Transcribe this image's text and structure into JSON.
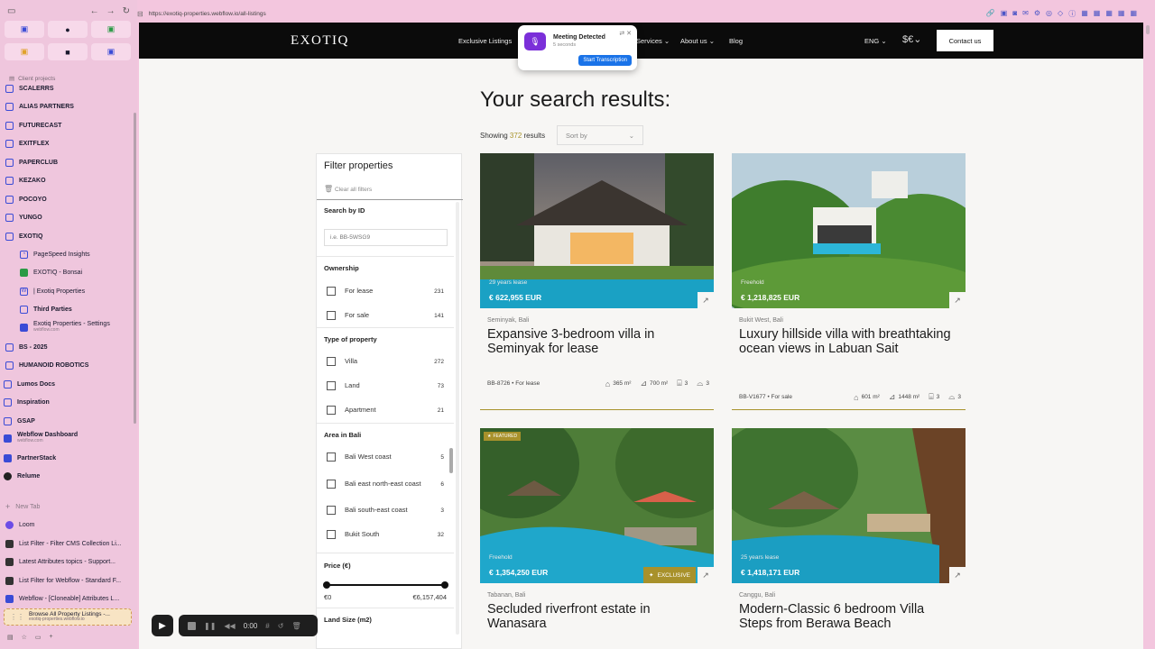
{
  "browser": {
    "url": "https://exotiq-properties.webflow.io/all-listings",
    "sidebar": {
      "section_label": "Client projects",
      "projects": [
        "SCALERRS",
        "ALIAS PARTNERS",
        "FUTURECAST",
        "EXITFLEX",
        "PAPERCLUB",
        "KEZAKO",
        "POCOYO",
        "YUNGO",
        "EXOTIQ"
      ],
      "exotiq_children": [
        {
          "label": "PageSpeed Insights"
        },
        {
          "label": "EXOTIQ - Bonsai"
        },
        {
          "label": "| Exotiq Properties"
        },
        {
          "label": "Third Parties"
        },
        {
          "label": "Exotiq Properties - Settings",
          "sub": "webflow.com"
        }
      ],
      "more_projects": [
        "BS - 2025",
        "HUMANOID ROBOTICS"
      ],
      "folders": [
        {
          "label": "Lumos Docs"
        },
        {
          "label": "Inspiration"
        },
        {
          "label": "GSAP"
        },
        {
          "label": "Webflow Dashboard",
          "sub": "webflow.com"
        },
        {
          "label": "PartnerStack"
        },
        {
          "label": "Relume"
        }
      ],
      "new_tab": "New Tab",
      "tabs": [
        "Loom",
        "List Filter - Filter CMS Collection Li...",
        "Latest Attributes topics - Support...",
        "List Filter for Webflow - Standard F...",
        "Webflow - [Cloneable] Attributes L..."
      ],
      "active_tab": {
        "label": "Browse All Property Listings -...",
        "sub": "exotiq-properties.webflow.io"
      }
    },
    "recorder": {
      "time": "0:00"
    }
  },
  "site": {
    "logo": "EXOTIQ",
    "nav": {
      "links": [
        "Exclusive Listings",
        "Services",
        "About us",
        "Blog"
      ],
      "language": "ENG",
      "contact": "Contact us"
    },
    "popup": {
      "title": "Meeting Detected",
      "subtitle": "5 seconds",
      "button": "Start Transcription"
    },
    "heading": "Your search results:",
    "showing": {
      "prefix": "Showing",
      "count": "372",
      "suffix": "results"
    },
    "sort_placeholder": "Sort by",
    "filter": {
      "title": "Filter properties",
      "clear": "Clear all filters",
      "search_label": "Search by ID",
      "search_placeholder": "i.e. BB-5WSG9",
      "ownership_label": "Ownership",
      "ownership": [
        {
          "label": "For lease",
          "count": "231"
        },
        {
          "label": "For sale",
          "count": "141"
        }
      ],
      "type_label": "Type of property",
      "types": [
        {
          "label": "Villa",
          "count": "272"
        },
        {
          "label": "Land",
          "count": "73"
        },
        {
          "label": "Apartment",
          "count": "21"
        }
      ],
      "area_label": "Area in Bali",
      "areas": [
        {
          "label": "Bali West coast",
          "count": "5"
        },
        {
          "label": "Bali east north-east coast",
          "count": "6"
        },
        {
          "label": "Bali south-east coast",
          "count": "3"
        },
        {
          "label": "Bukit South",
          "count": "32"
        }
      ],
      "price_label": "Price (€)",
      "price_min": "€0",
      "price_max": "€6,157,404",
      "land_label": "Land Size (m2)"
    },
    "listings": [
      {
        "tag": "29 years lease",
        "price": "€ 622,955 EUR",
        "location": "Seminyak, Bali",
        "title": "Expansive 3-bedroom villa in Seminyak for lease",
        "id": "BB-8726",
        "status": "For lease",
        "building": "365 m²",
        "land": "700 m²",
        "beds": "3",
        "baths": "3"
      },
      {
        "tag": "Freehold",
        "price": "€ 1,218,825 EUR",
        "location": "Bukit West, Bali",
        "title": "Luxury hillside villa with breathtaking ocean views in Labuan Sait",
        "id": "BB-V1677",
        "status": "For sale",
        "building": "601 m²",
        "land": "1448 m²",
        "beds": "3",
        "baths": "3"
      },
      {
        "tag": "Freehold",
        "price": "€ 1,354,250 EUR",
        "location": "Tabanan, Bali",
        "title": "Secluded riverfront estate in Wanasara",
        "featured": "FEATURED",
        "exclusive": "EXCLUSIVE"
      },
      {
        "tag": "25 years lease",
        "price": "€ 1,418,171 EUR",
        "location": "Canggu, Bali",
        "title": "Modern-Classic 6 bedroom Villa Steps from Berawa Beach"
      }
    ]
  }
}
